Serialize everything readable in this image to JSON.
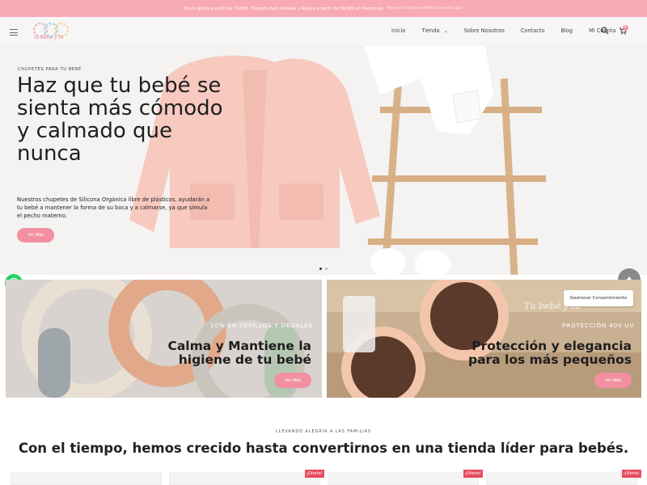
{
  "promo": {
    "text": "Envío gratis a partir de 19,90€. Excepto Pack Pañales y Azalvo a partir de 59,90€ en Península.",
    "small": "*Revisar condiciones Política de envíos aquí"
  },
  "header": {
    "logo_text": "tu bebé y tú",
    "nav": [
      {
        "label": "Inicio"
      },
      {
        "label": "Tienda"
      },
      {
        "label": "Sobre Nosotros"
      },
      {
        "label": "Contacto"
      },
      {
        "label": "Blog"
      },
      {
        "label": "Mi Cuenta"
      }
    ],
    "cart_count": "0"
  },
  "hero": {
    "eyebrow": "CHUPETES PARA TU BEBÉ",
    "title": "Haz que tu bebé se sienta más cómodo y calmado que nunca",
    "description": "Nuestros chupetes de Silicona Orgánica libre de plásticos, ayudarán a tu bebé a mantener la forma de su boca y a calmarse, ya que simula el pecho materno.",
    "button": "Ver Más"
  },
  "cards": [
    {
      "eyebrow": "10% EN CEPILLOS Y DEDALES",
      "title": "Calma y Mantiene la higiene de tu bebé",
      "button": "Ver Más"
    },
    {
      "eyebrow": "PROTECCIÓN 400 UV",
      "watermark": "Tu bebé y tú",
      "title": "Protección y elegancia para los más pequeños",
      "button": "Ver Más"
    }
  ],
  "consent": "Gestionar Consentimiento",
  "section": {
    "eyebrow": "LLEVANDO ALEGRÍA A LAS FAMILIAS",
    "title": "Con el tiempo, hemos crecido hasta convertirnos en una tienda líder para bebés."
  },
  "badges": {
    "oferta": "¡Oferta!"
  },
  "colors": {
    "accent": "#f28fa1",
    "promo_bar": "#f7a9b4",
    "whatsapp": "#25d366"
  }
}
